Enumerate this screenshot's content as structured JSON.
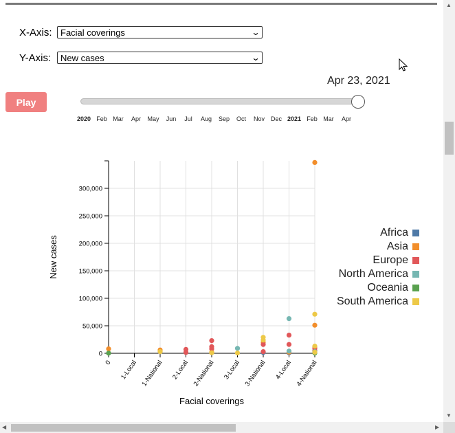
{
  "controls": {
    "x_label": "X-Axis:",
    "x_value": "Facial coverings",
    "y_label": "Y-Axis:",
    "y_value": "New cases",
    "play_label": "Play",
    "current_date": "Apr 23, 2021",
    "slider_progress": 1.0,
    "months": [
      {
        "label": "2020",
        "year": true
      },
      {
        "label": "Feb"
      },
      {
        "label": "Mar"
      },
      {
        "label": "Apr"
      },
      {
        "label": "May"
      },
      {
        "label": "Jun"
      },
      {
        "label": "Jul"
      },
      {
        "label": "Aug"
      },
      {
        "label": "Sep"
      },
      {
        "label": "Oct"
      },
      {
        "label": "Nov"
      },
      {
        "label": "Dec"
      },
      {
        "label": "2021",
        "year": true
      },
      {
        "label": "Feb"
      },
      {
        "label": "Mar"
      },
      {
        "label": "Apr"
      }
    ]
  },
  "chart_data": {
    "type": "scatter",
    "xlabel": "Facial coverings",
    "ylabel": "New cases",
    "categories": [
      "0",
      "1-Local",
      "1-National",
      "2-Local",
      "2-National",
      "3-Local",
      "3-National",
      "4-Local",
      "4-National"
    ],
    "ylim": [
      0,
      350000
    ],
    "yticks": [
      0,
      50000,
      100000,
      150000,
      200000,
      250000,
      300000
    ],
    "ytick_labels": [
      "0",
      "50,000",
      "100,000",
      "150,000",
      "200,000",
      "250,000",
      "300,000"
    ],
    "grid": true,
    "legend_position": "right",
    "series": [
      {
        "name": "Africa",
        "color": "#4e79a7",
        "points": [
          {
            "x": "3-National",
            "y": 1500
          },
          {
            "x": "4-National",
            "y": 1000
          },
          {
            "x": "4-Local",
            "y": 800
          }
        ]
      },
      {
        "name": "Asia",
        "color": "#f28e2b",
        "points": [
          {
            "x": "0",
            "y": 8000
          },
          {
            "x": "1-National",
            "y": 6000
          },
          {
            "x": "2-National",
            "y": 2000
          },
          {
            "x": "3-National",
            "y": 20000
          },
          {
            "x": "4-National",
            "y": 347000
          },
          {
            "x": "4-National",
            "y": 51000
          },
          {
            "x": "4-National",
            "y": 12000
          },
          {
            "x": "4-National",
            "y": 4000
          },
          {
            "x": "4-Local",
            "y": 2000
          }
        ]
      },
      {
        "name": "Europe",
        "color": "#e15759",
        "points": [
          {
            "x": "2-Local",
            "y": 7000
          },
          {
            "x": "2-Local",
            "y": 1500
          },
          {
            "x": "2-National",
            "y": 23000
          },
          {
            "x": "2-National",
            "y": 12000
          },
          {
            "x": "2-National",
            "y": 8000
          },
          {
            "x": "3-National",
            "y": 16000
          },
          {
            "x": "3-National",
            "y": 3000
          },
          {
            "x": "4-Local",
            "y": 33000
          },
          {
            "x": "4-Local",
            "y": 16000
          },
          {
            "x": "4-National",
            "y": 9000
          },
          {
            "x": "4-National",
            "y": 5000
          }
        ]
      },
      {
        "name": "North America",
        "color": "#76b7b2",
        "points": [
          {
            "x": "3-Local",
            "y": 9000
          },
          {
            "x": "4-Local",
            "y": 63000
          },
          {
            "x": "4-Local",
            "y": 4000
          },
          {
            "x": "4-National",
            "y": 3000
          }
        ]
      },
      {
        "name": "Oceania",
        "color": "#59a14f",
        "points": [
          {
            "x": "0",
            "y": 200
          },
          {
            "x": "4-National",
            "y": 300
          }
        ]
      },
      {
        "name": "South America",
        "color": "#edc948",
        "points": [
          {
            "x": "1-National",
            "y": 3000
          },
          {
            "x": "2-National",
            "y": 1000
          },
          {
            "x": "3-Local",
            "y": 500
          },
          {
            "x": "3-National",
            "y": 29000
          },
          {
            "x": "3-National",
            "y": 24000
          },
          {
            "x": "4-National",
            "y": 71000
          },
          {
            "x": "4-National",
            "y": 13000
          },
          {
            "x": "4-National",
            "y": 2000
          }
        ]
      }
    ]
  }
}
